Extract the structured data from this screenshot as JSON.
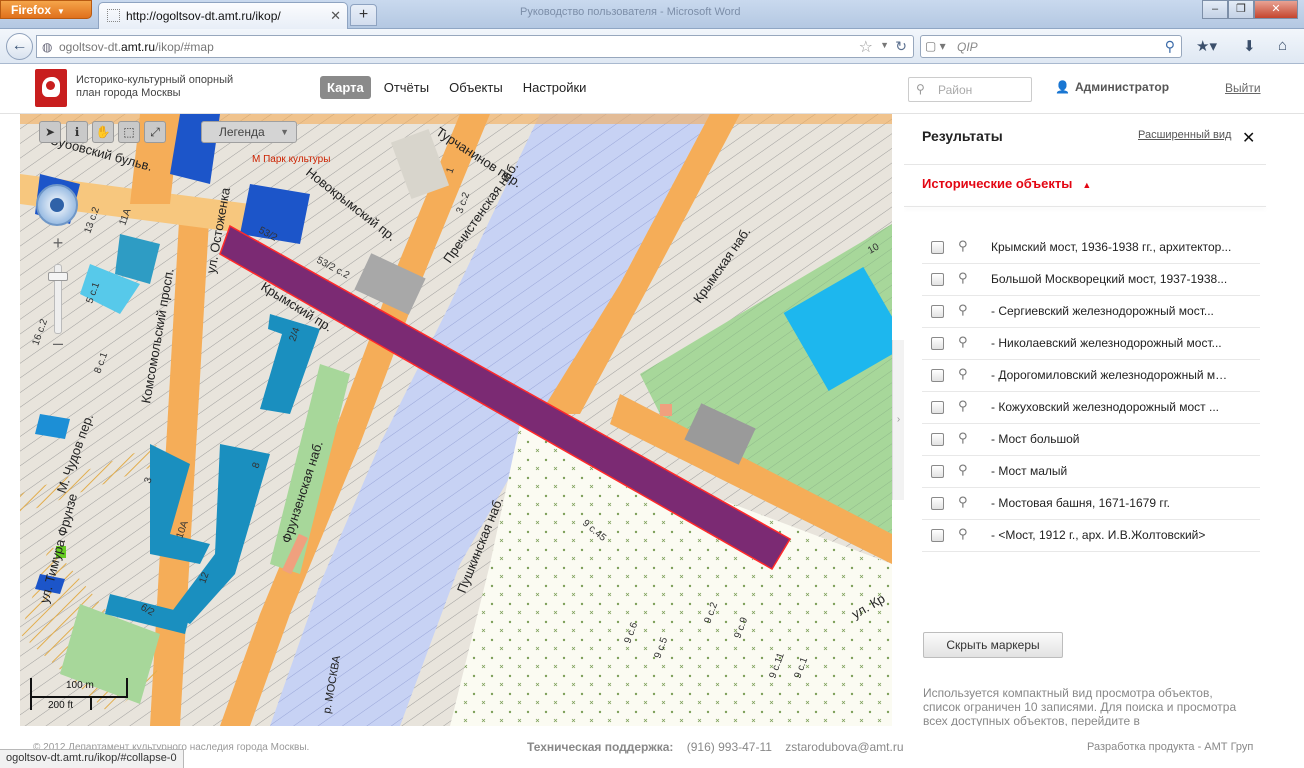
{
  "browser": {
    "app_button": "Firefox",
    "tab_title": "http://ogoltsov-dt.amt.ru/ikop/",
    "window_title": "Руководство пользователя - Microsoft Word",
    "url_host": "ogoltsov-dt.amt.ru",
    "url_path": "/ikop/#map",
    "url_prefix": "ogoltsov-dt.",
    "url_bold": "amt.ru",
    "search_placeholder": "QIP",
    "status_url": "ogoltsov-dt.amt.ru/ikop/#collapse-0"
  },
  "app": {
    "title_line1": "Историко-культурный опорный",
    "title_line2": "план города Москвы",
    "nav": [
      {
        "label": "Карта",
        "active": true
      },
      {
        "label": "Отчёты",
        "active": false
      },
      {
        "label": "Объекты",
        "active": false
      },
      {
        "label": "Настройки",
        "active": false
      }
    ],
    "district_placeholder": "Район",
    "user": "Администратор",
    "logout": "Выйти",
    "accent_color": "#e30613"
  },
  "map": {
    "legend_label": "Легенда",
    "scale_m": "100 m",
    "scale_ft": "200 ft",
    "metro_label": "М Парк культуры",
    "street_labels": [
      "Турчанинов пер.",
      "Пречистенская наб.",
      "Новокрымский пр.",
      "Крымский пр.",
      "Крымская наб.",
      "Фрунзенская наб.",
      "Пушкинская наб.",
      "Комсомольский просп.",
      "ул. Остоженка",
      "Зубовский бульв.",
      "ул. Тимура Фрунзе",
      "М. Чудов пер.",
      "р. МОСКВА",
      "ул. Кр"
    ],
    "building_labels": [
      "53/2",
      "53/2 с.2",
      "9 с.45",
      "9 с.2",
      "9 с.9",
      "9 с.6",
      "9 с.5",
      "9 с.11",
      "9 с.1",
      "10А",
      "10",
      "8",
      "12",
      "3",
      "1",
      "6/2",
      "2/4",
      "13 с.2",
      "11А",
      "5 с.1",
      "16 с.2",
      "3 с.2",
      "8 с.1"
    ],
    "highlight_color": "#7b2a73",
    "river_color": "#c9d3f5"
  },
  "results": {
    "title": "Результаты",
    "extended_view": "Расширенный вид",
    "section_title": "Исторические объекты",
    "items": [
      {
        "label": "Крымский мост, 1936-1938 гг., архитектор..."
      },
      {
        "label": "Большой Москворецкий мост, 1937-1938..."
      },
      {
        "label": "- Сергиевский железнодорожный мост..."
      },
      {
        "label": "- Николаевский железнодорожный мост..."
      },
      {
        "label": "- Дорогомиловский железнодорожный мост..."
      },
      {
        "label": "- Кожуховский железнодорожный мост ..."
      },
      {
        "label": "- Мост большой"
      },
      {
        "label": "- Мост малый"
      },
      {
        "label": "- Мостовая башня, 1671-1679 гг."
      },
      {
        "label": "- <Мост, 1912 г., арх. И.В.Жолтовский>"
      }
    ],
    "hide_markers": "Скрыть маркеры",
    "note": "Используется компактный вид просмотра объектов, список ограничен 10 записями. Для поиска и просмотра всех доступных объектов, перейдите в"
  },
  "footer": {
    "copyright": "© 2012 Департамент культурного наследия города Москвы.",
    "support_label": "Техническая поддержка:",
    "phone": "(916) 993-47-11",
    "email": "zstarodubova@amt.ru",
    "developer": "Разработка продукта - АМТ Груп"
  }
}
